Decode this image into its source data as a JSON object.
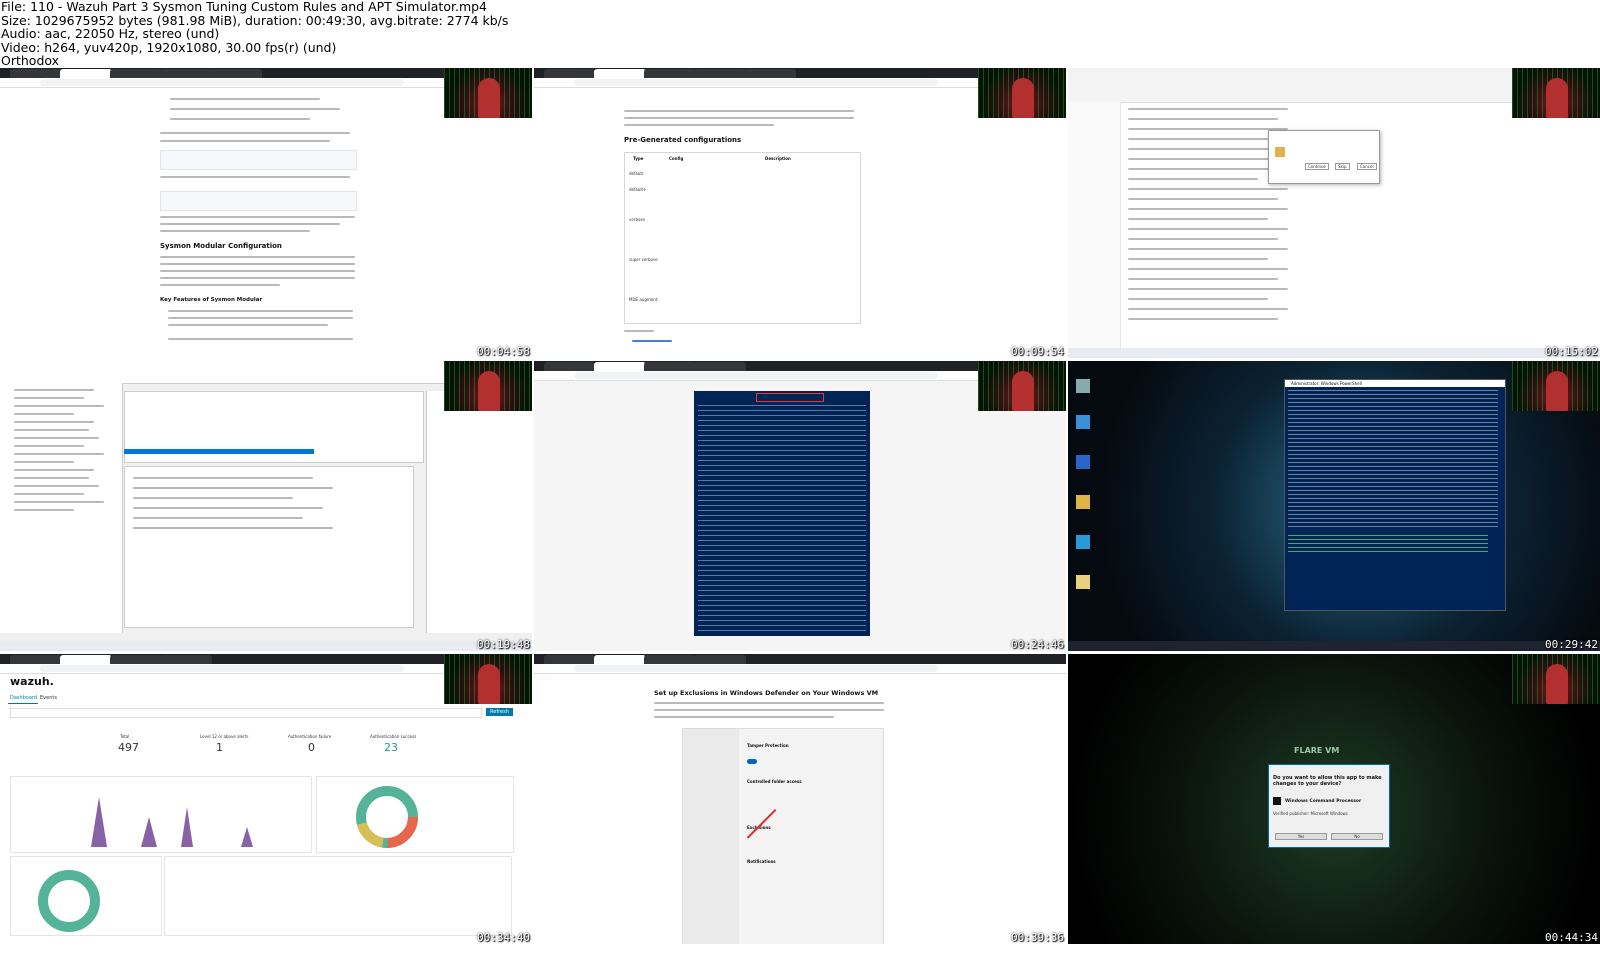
{
  "header": {
    "file_line": "File: 110 - Wazuh Part 3 Sysmon Tuning Custom Rules and APT Simulator.mp4",
    "size_line": "Size: 1029675952 bytes (981.98 MiB), duration: 00:49:30, avg.bitrate: 2774 kb/s",
    "audio_line": "Audio: aac, 22050 Hz, stereo (und)",
    "video_line": "Video: h264, yuv420p, 1920x1080, 30.00 fps(r) (und)",
    "tag_line": "Orthodox"
  },
  "thumbnails": [
    {
      "timestamp": "00:04:58",
      "headings": [
        "Sysmon Modular Configuration",
        "Key Features of Sysmon Modular"
      ]
    },
    {
      "timestamp": "00:09:54",
      "headings": [
        "Pre-Generated configurations"
      ],
      "table_headers": [
        "Type",
        "Config",
        "Description"
      ],
      "rows": [
        "default",
        "default+",
        "verbose",
        "super verbose",
        "MDE augment"
      ]
    },
    {
      "timestamp": "00:15:02",
      "dialog_buttons": [
        "Continue",
        "Skip",
        "Cancel"
      ]
    },
    {
      "timestamp": "00:19:48"
    },
    {
      "timestamp": "00:24:46"
    },
    {
      "timestamp": "00:29:42",
      "window_title": "Administrator: Windows PowerShell"
    },
    {
      "timestamp": "00:34:40",
      "app": "wazuh.",
      "tabs": [
        "Dashboard",
        "Events"
      ],
      "stats": [
        {
          "label": "Total",
          "value": "497"
        },
        {
          "label": "Level 12 or above alerts",
          "value": "1"
        },
        {
          "label": "Authentication failure",
          "value": "0"
        },
        {
          "label": "Authentication success",
          "value": "23"
        }
      ],
      "refresh_label": "Refresh"
    },
    {
      "timestamp": "00:39:36",
      "title": "Set up Exclusions in Windows Defender on Your Windows VM",
      "sections": [
        "Tamper Protection",
        "Controlled folder access",
        "Exclusions",
        "Notifications"
      ]
    },
    {
      "timestamp": "00:44:34",
      "uac": {
        "title": "Do you want to allow this app to make changes to your device?",
        "app": "Windows Command Processor",
        "publisher": "Verified publisher: Microsoft Windows",
        "yes": "Yes",
        "no": "No"
      },
      "logo": "FLARE VM"
    }
  ]
}
